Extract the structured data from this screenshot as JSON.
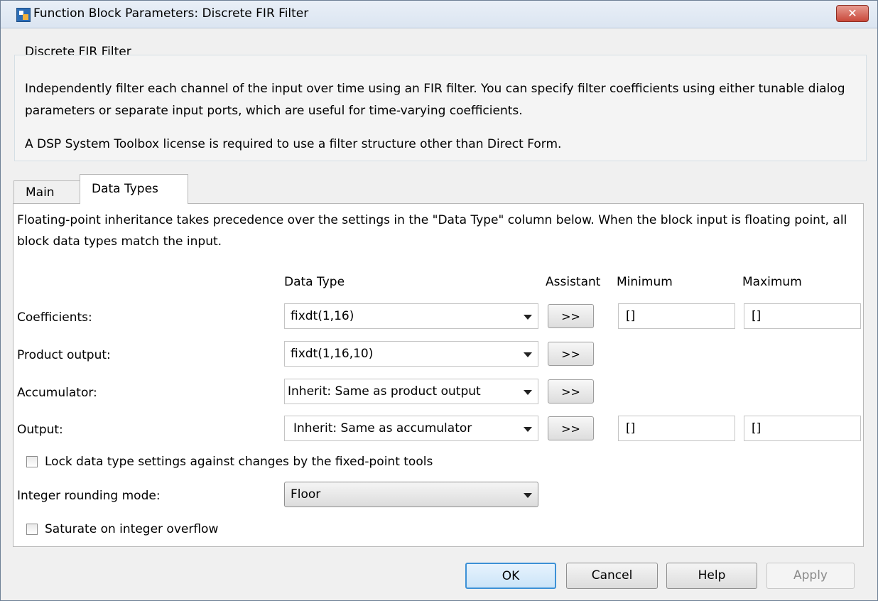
{
  "window": {
    "title": "Function Block Parameters: Discrete FIR Filter",
    "close_label": "✕"
  },
  "block": {
    "group_title": "Discrete FIR Filter",
    "description": "Independently filter each channel of the input over time using an FIR filter. You can specify filter coefficients using either tunable dialog parameters or separate input ports, which are useful for time-varying coefficients.",
    "license_note": "A DSP System Toolbox license is required to use a filter structure other than Direct Form."
  },
  "tabs": [
    {
      "label": "Main",
      "selected": false
    },
    {
      "label": "Data Types",
      "selected": true
    }
  ],
  "data_types": {
    "note": "Floating-point inheritance takes precedence over the settings in the \"Data Type\" column below. When the block input is floating point, all block data types match the input.",
    "headers": {
      "data_type": "Data Type",
      "assistant": "Assistant",
      "minimum": "Minimum",
      "maximum": "Maximum"
    },
    "assistant_label": ">>",
    "rows": [
      {
        "label": "Coefficients:",
        "value": "fixdt(1,16)",
        "minimum": "[]",
        "maximum": "[]"
      },
      {
        "label": "Product output:",
        "value": "fixdt(1,16,10)"
      },
      {
        "label": "Accumulator:",
        "value": "Inherit: Same as product output"
      },
      {
        "label": "Output:",
        "value": "Inherit: Same as accumulator",
        "minimum": "[]",
        "maximum": "[]"
      }
    ],
    "lock_label": "Lock data type settings against changes by the fixed-point tools",
    "lock_checked": false,
    "rounding_label": "Integer rounding mode:",
    "rounding_value": "Floor",
    "saturate_label": "Saturate on integer overflow",
    "saturate_checked": false
  },
  "buttons": {
    "ok": "OK",
    "cancel": "Cancel",
    "help": "Help",
    "apply": "Apply"
  },
  "icons": [
    "matlab-block-icon",
    "close-icon",
    "dropdown-caret-icon",
    "checkbox-icon"
  ],
  "colors": {
    "title_bar": "#dbe5f1",
    "close_button": "#c9483a",
    "focused_button_border": "#3d91d6",
    "panel_background": "#ffffff"
  }
}
